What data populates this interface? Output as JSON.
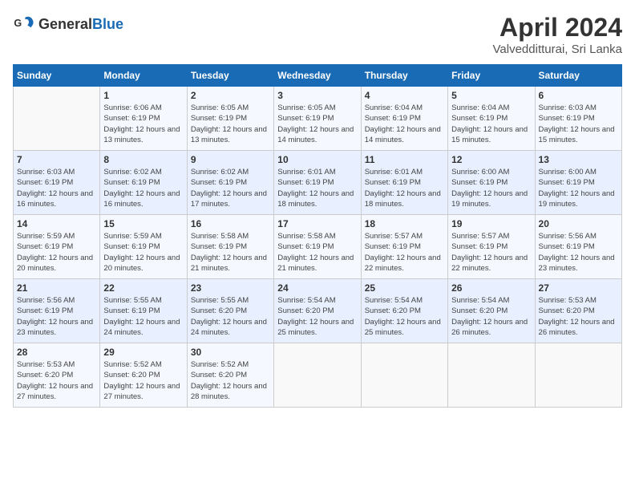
{
  "header": {
    "logo_general": "General",
    "logo_blue": "Blue",
    "month_year": "April 2024",
    "location": "Valvedditturai, Sri Lanka"
  },
  "days_of_week": [
    "Sunday",
    "Monday",
    "Tuesday",
    "Wednesday",
    "Thursday",
    "Friday",
    "Saturday"
  ],
  "weeks": [
    [
      {
        "day": "",
        "sunrise": "",
        "sunset": "",
        "daylight": "",
        "empty": true
      },
      {
        "day": "1",
        "sunrise": "Sunrise: 6:06 AM",
        "sunset": "Sunset: 6:19 PM",
        "daylight": "Daylight: 12 hours and 13 minutes."
      },
      {
        "day": "2",
        "sunrise": "Sunrise: 6:05 AM",
        "sunset": "Sunset: 6:19 PM",
        "daylight": "Daylight: 12 hours and 13 minutes."
      },
      {
        "day": "3",
        "sunrise": "Sunrise: 6:05 AM",
        "sunset": "Sunset: 6:19 PM",
        "daylight": "Daylight: 12 hours and 14 minutes."
      },
      {
        "day": "4",
        "sunrise": "Sunrise: 6:04 AM",
        "sunset": "Sunset: 6:19 PM",
        "daylight": "Daylight: 12 hours and 14 minutes."
      },
      {
        "day": "5",
        "sunrise": "Sunrise: 6:04 AM",
        "sunset": "Sunset: 6:19 PM",
        "daylight": "Daylight: 12 hours and 15 minutes."
      },
      {
        "day": "6",
        "sunrise": "Sunrise: 6:03 AM",
        "sunset": "Sunset: 6:19 PM",
        "daylight": "Daylight: 12 hours and 15 minutes."
      }
    ],
    [
      {
        "day": "7",
        "sunrise": "Sunrise: 6:03 AM",
        "sunset": "Sunset: 6:19 PM",
        "daylight": "Daylight: 12 hours and 16 minutes."
      },
      {
        "day": "8",
        "sunrise": "Sunrise: 6:02 AM",
        "sunset": "Sunset: 6:19 PM",
        "daylight": "Daylight: 12 hours and 16 minutes."
      },
      {
        "day": "9",
        "sunrise": "Sunrise: 6:02 AM",
        "sunset": "Sunset: 6:19 PM",
        "daylight": "Daylight: 12 hours and 17 minutes."
      },
      {
        "day": "10",
        "sunrise": "Sunrise: 6:01 AM",
        "sunset": "Sunset: 6:19 PM",
        "daylight": "Daylight: 12 hours and 18 minutes."
      },
      {
        "day": "11",
        "sunrise": "Sunrise: 6:01 AM",
        "sunset": "Sunset: 6:19 PM",
        "daylight": "Daylight: 12 hours and 18 minutes."
      },
      {
        "day": "12",
        "sunrise": "Sunrise: 6:00 AM",
        "sunset": "Sunset: 6:19 PM",
        "daylight": "Daylight: 12 hours and 19 minutes."
      },
      {
        "day": "13",
        "sunrise": "Sunrise: 6:00 AM",
        "sunset": "Sunset: 6:19 PM",
        "daylight": "Daylight: 12 hours and 19 minutes."
      }
    ],
    [
      {
        "day": "14",
        "sunrise": "Sunrise: 5:59 AM",
        "sunset": "Sunset: 6:19 PM",
        "daylight": "Daylight: 12 hours and 20 minutes."
      },
      {
        "day": "15",
        "sunrise": "Sunrise: 5:59 AM",
        "sunset": "Sunset: 6:19 PM",
        "daylight": "Daylight: 12 hours and 20 minutes."
      },
      {
        "day": "16",
        "sunrise": "Sunrise: 5:58 AM",
        "sunset": "Sunset: 6:19 PM",
        "daylight": "Daylight: 12 hours and 21 minutes."
      },
      {
        "day": "17",
        "sunrise": "Sunrise: 5:58 AM",
        "sunset": "Sunset: 6:19 PM",
        "daylight": "Daylight: 12 hours and 21 minutes."
      },
      {
        "day": "18",
        "sunrise": "Sunrise: 5:57 AM",
        "sunset": "Sunset: 6:19 PM",
        "daylight": "Daylight: 12 hours and 22 minutes."
      },
      {
        "day": "19",
        "sunrise": "Sunrise: 5:57 AM",
        "sunset": "Sunset: 6:19 PM",
        "daylight": "Daylight: 12 hours and 22 minutes."
      },
      {
        "day": "20",
        "sunrise": "Sunrise: 5:56 AM",
        "sunset": "Sunset: 6:19 PM",
        "daylight": "Daylight: 12 hours and 23 minutes."
      }
    ],
    [
      {
        "day": "21",
        "sunrise": "Sunrise: 5:56 AM",
        "sunset": "Sunset: 6:19 PM",
        "daylight": "Daylight: 12 hours and 23 minutes."
      },
      {
        "day": "22",
        "sunrise": "Sunrise: 5:55 AM",
        "sunset": "Sunset: 6:19 PM",
        "daylight": "Daylight: 12 hours and 24 minutes."
      },
      {
        "day": "23",
        "sunrise": "Sunrise: 5:55 AM",
        "sunset": "Sunset: 6:20 PM",
        "daylight": "Daylight: 12 hours and 24 minutes."
      },
      {
        "day": "24",
        "sunrise": "Sunrise: 5:54 AM",
        "sunset": "Sunset: 6:20 PM",
        "daylight": "Daylight: 12 hours and 25 minutes."
      },
      {
        "day": "25",
        "sunrise": "Sunrise: 5:54 AM",
        "sunset": "Sunset: 6:20 PM",
        "daylight": "Daylight: 12 hours and 25 minutes."
      },
      {
        "day": "26",
        "sunrise": "Sunrise: 5:54 AM",
        "sunset": "Sunset: 6:20 PM",
        "daylight": "Daylight: 12 hours and 26 minutes."
      },
      {
        "day": "27",
        "sunrise": "Sunrise: 5:53 AM",
        "sunset": "Sunset: 6:20 PM",
        "daylight": "Daylight: 12 hours and 26 minutes."
      }
    ],
    [
      {
        "day": "28",
        "sunrise": "Sunrise: 5:53 AM",
        "sunset": "Sunset: 6:20 PM",
        "daylight": "Daylight: 12 hours and 27 minutes."
      },
      {
        "day": "29",
        "sunrise": "Sunrise: 5:52 AM",
        "sunset": "Sunset: 6:20 PM",
        "daylight": "Daylight: 12 hours and 27 minutes."
      },
      {
        "day": "30",
        "sunrise": "Sunrise: 5:52 AM",
        "sunset": "Sunset: 6:20 PM",
        "daylight": "Daylight: 12 hours and 28 minutes."
      },
      {
        "day": "",
        "sunrise": "",
        "sunset": "",
        "daylight": "",
        "empty": true
      },
      {
        "day": "",
        "sunrise": "",
        "sunset": "",
        "daylight": "",
        "empty": true
      },
      {
        "day": "",
        "sunrise": "",
        "sunset": "",
        "daylight": "",
        "empty": true
      },
      {
        "day": "",
        "sunrise": "",
        "sunset": "",
        "daylight": "",
        "empty": true
      }
    ]
  ]
}
